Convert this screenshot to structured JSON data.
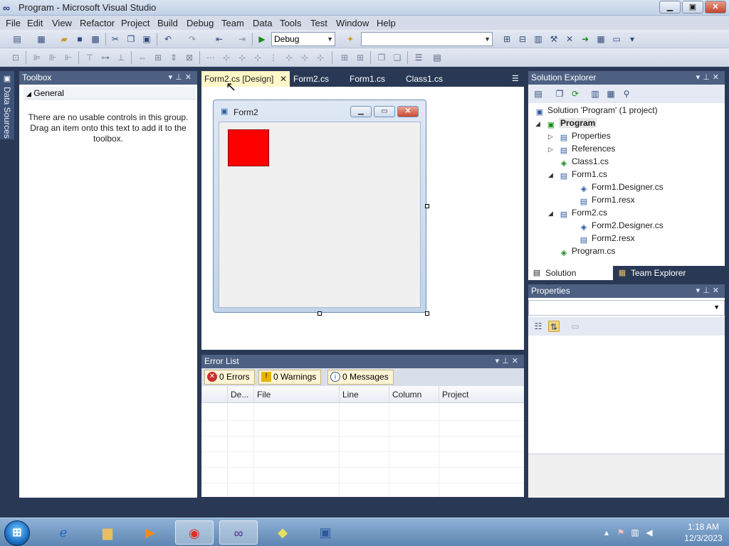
{
  "window": {
    "title": "Program - Microsoft Visual Studio",
    "controls": {
      "minimize": "▁",
      "maximize": "▣",
      "close": "✕"
    }
  },
  "menu": [
    "File",
    "Edit",
    "View",
    "Refactor",
    "Project",
    "Build",
    "Debug",
    "Team",
    "Data",
    "Tools",
    "Test",
    "Window",
    "Help"
  ],
  "toolbar": {
    "config_value": "Debug",
    "platform_value": ""
  },
  "side_strip": {
    "label": "Data Sources"
  },
  "toolbox": {
    "title": "Toolbox",
    "group": "General",
    "empty_message": "There are no usable controls in this group. Drag an item onto this text to add it to the toolbox."
  },
  "tabs": [
    {
      "label": "Form2.cs [Design]",
      "active": true
    },
    {
      "label": "Form2.cs",
      "active": false
    },
    {
      "label": "Form1.cs",
      "active": false
    },
    {
      "label": "Class1.cs",
      "active": false
    }
  ],
  "designer": {
    "form_title": "Form2",
    "red_box_color": "#ff0000"
  },
  "error_list": {
    "title": "Error List",
    "errors": "0 Errors",
    "warnings": "0 Warnings",
    "messages": "0 Messages",
    "columns": [
      "De...",
      "File",
      "Line",
      "Column",
      "Project"
    ]
  },
  "solution_explorer": {
    "title": "Solution Explorer",
    "items": [
      {
        "label": "Solution 'Program' (1 project)",
        "icon": "solution-icon"
      },
      {
        "label": "Program",
        "icon": "csharp-project-icon"
      },
      {
        "label": "Properties",
        "icon": "properties-folder-icon"
      },
      {
        "label": "References",
        "icon": "references-folder-icon"
      },
      {
        "label": "Class1.cs",
        "icon": "csharp-file-icon"
      },
      {
        "label": "Form1.cs",
        "icon": "form-file-icon"
      },
      {
        "label": "Form1.Designer.cs",
        "icon": "csharp-file-icon"
      },
      {
        "label": "Form1.resx",
        "icon": "resx-file-icon"
      },
      {
        "label": "Form2.cs",
        "icon": "form-file-icon"
      },
      {
        "label": "Form2.Designer.cs",
        "icon": "csharp-file-icon"
      },
      {
        "label": "Form2.resx",
        "icon": "resx-file-icon"
      },
      {
        "label": "Program.cs",
        "icon": "csharp-file-icon"
      }
    ],
    "tabs": [
      "Solution Explorer",
      "Team Explorer"
    ]
  },
  "properties": {
    "title": "Properties"
  },
  "taskbar": {
    "time": "1:18 AM",
    "date": "12/3/2023",
    "apps": [
      "internet-explorer-icon",
      "file-explorer-icon",
      "media-player-icon",
      "chrome-icon",
      "visual-studio-icon",
      "sticky-notes-icon",
      "remote-desktop-icon"
    ]
  }
}
